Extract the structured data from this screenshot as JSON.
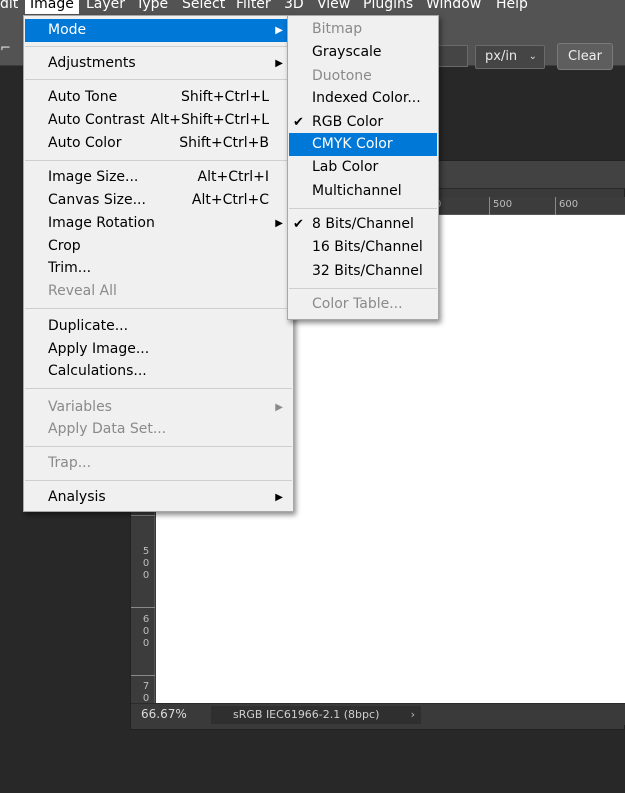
{
  "menubar": {
    "items": [
      "dit",
      "Image",
      "Layer",
      "Type",
      "Select",
      "Filter",
      "3D",
      "View",
      "Plugins",
      "Window",
      "Help"
    ]
  },
  "options_bar": {
    "unit_select": "px/in",
    "clear_button": "Clear"
  },
  "image_menu": {
    "items": [
      {
        "label": "Mode"
      },
      {
        "label": "Adjustments"
      },
      {
        "label": "Auto Tone",
        "shortcut": "Shift+Ctrl+L"
      },
      {
        "label": "Auto Contrast",
        "shortcut": "Alt+Shift+Ctrl+L"
      },
      {
        "label": "Auto Color",
        "shortcut": "Shift+Ctrl+B"
      },
      {
        "label": "Image Size...",
        "shortcut": "Alt+Ctrl+I"
      },
      {
        "label": "Canvas Size...",
        "shortcut": "Alt+Ctrl+C"
      },
      {
        "label": "Image Rotation"
      },
      {
        "label": "Crop"
      },
      {
        "label": "Trim..."
      },
      {
        "label": "Reveal All"
      },
      {
        "label": "Duplicate..."
      },
      {
        "label": "Apply Image..."
      },
      {
        "label": "Calculations..."
      },
      {
        "label": "Variables"
      },
      {
        "label": "Apply Data Set..."
      },
      {
        "label": "Trap..."
      },
      {
        "label": "Analysis"
      }
    ]
  },
  "mode_submenu": {
    "items": [
      {
        "label": "Bitmap"
      },
      {
        "label": "Grayscale"
      },
      {
        "label": "Duotone"
      },
      {
        "label": "Indexed Color..."
      },
      {
        "label": "RGB Color"
      },
      {
        "label": "CMYK Color"
      },
      {
        "label": "Lab Color"
      },
      {
        "label": "Multichannel"
      },
      {
        "label": "8 Bits/Channel"
      },
      {
        "label": "16 Bits/Channel"
      },
      {
        "label": "32 Bits/Channel"
      },
      {
        "label": "Color Table..."
      }
    ],
    "check_glyph": "✔"
  },
  "ruler": {
    "top_labels": [
      "0",
      "500",
      "600"
    ],
    "left_labels": [
      "5",
      "0",
      "0",
      "6",
      "0",
      "0",
      "7",
      "0"
    ]
  },
  "status": {
    "zoom": "66.67%",
    "profile": "sRGB IEC61966-2.1 (8bpc)"
  },
  "colors": {
    "highlight": "#0078d7",
    "menu_bg": "#f0f0f0",
    "app_bg": "#282828",
    "bar_bg": "#535353"
  }
}
